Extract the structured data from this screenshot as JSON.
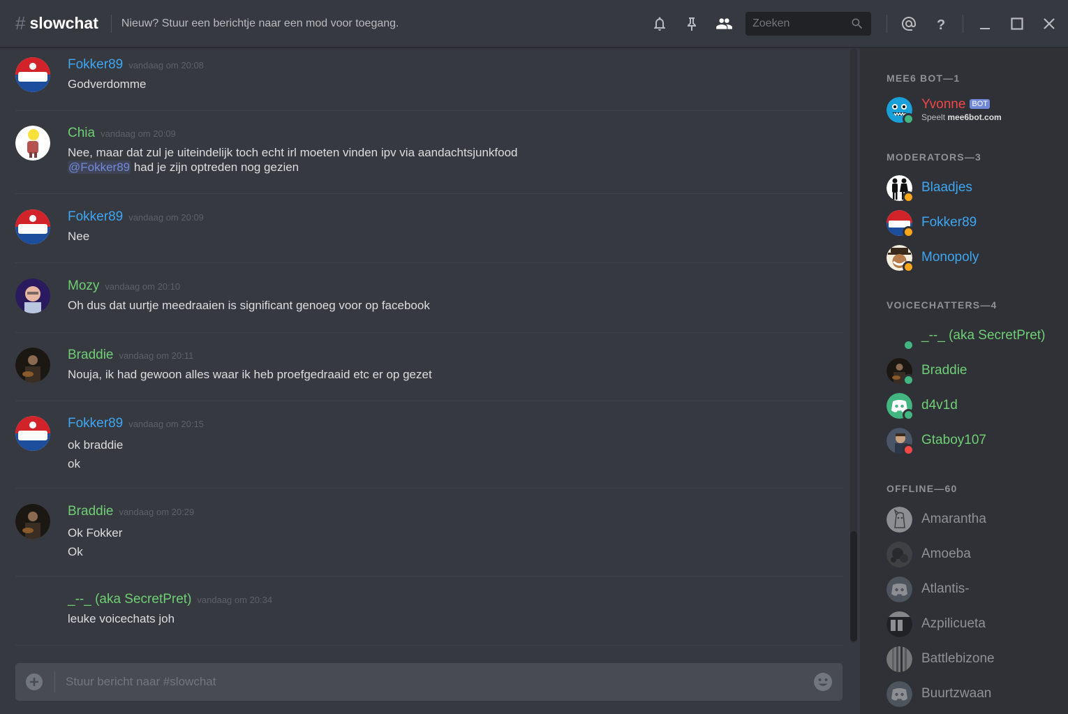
{
  "header": {
    "channel": "slowchat",
    "topic": "Nieuw? Stuur een berichtje naar een mod voor toegang.",
    "search_placeholder": "Zoeken",
    "icons": [
      "bell-icon",
      "pin-icon",
      "members-icon",
      "search-icon",
      "at-icon",
      "help-icon",
      "minimize-icon",
      "maximize-icon",
      "close-icon"
    ]
  },
  "colors": {
    "mod_blue": "#3ea6f2",
    "green": "#6fcf75",
    "red": "#f04747",
    "online": "#43b581",
    "idle": "#faa61a",
    "dnd": "#f04747",
    "background": "#36393f",
    "sidebar": "#2f3136"
  },
  "messages": [
    {
      "author": "Fokker89",
      "time": "vandaag om 20:08",
      "lines": [
        "Godverdomme"
      ]
    },
    {
      "author": "Chia",
      "time": "vandaag om 20:09",
      "lines": [
        "Nee, maar dat zul je uiteindelijk toch echt irl moeten vinden ipv via aandachtsjunkfood"
      ],
      "mention": "@Fokker89",
      "mention_rest": " had je zijn optreden nog gezien"
    },
    {
      "author": "Fokker89",
      "time": "vandaag om 20:09",
      "lines": [
        "Nee"
      ]
    },
    {
      "author": "Mozy",
      "time": "vandaag om 20:10",
      "lines": [
        "Oh dus dat uurtje meedraaien is significant genoeg voor op facebook"
      ]
    },
    {
      "author": "Braddie",
      "time": "vandaag om 20:11",
      "lines": [
        "Nouja, ik had gewoon alles waar ik heb proefgedraaid etc er op gezet"
      ]
    },
    {
      "author": "Fokker89",
      "time": "vandaag om 20:15",
      "lines": [
        "ok braddie",
        "ok"
      ]
    },
    {
      "author": "Braddie",
      "time": "vandaag om 20:29",
      "lines": [
        "Ok Fokker",
        "Ok"
      ]
    },
    {
      "author": "_--_ (aka SecretPret)",
      "time": "vandaag om 20:34",
      "lines": [
        "leuke voicechats joh"
      ]
    }
  ],
  "composer": {
    "placeholder": "Stuur bericht naar #slowchat"
  },
  "members": {
    "groups": [
      {
        "title": "MEE6 BOT—1"
      },
      {
        "title": "MODERATORS—3"
      },
      {
        "title": "VOICECHATTERS—4"
      },
      {
        "title": "OFFLINE—60"
      }
    ],
    "bot": {
      "name": "Yvonne",
      "tag": "BOT",
      "activity_prefix": "Speelt ",
      "activity": "mee6bot.com"
    },
    "moderators": [
      "Blaadjes",
      "Fokker89",
      "Monopoly"
    ],
    "voicechatters": [
      "_--_ (aka SecretPret)",
      "Braddie",
      "d4v1d",
      "Gtaboy107"
    ],
    "offline": [
      "Amarantha",
      "Amoeba",
      "Atlantis-",
      "Azpilicueta",
      "Battlebizone",
      "Buurtzwaan"
    ]
  }
}
